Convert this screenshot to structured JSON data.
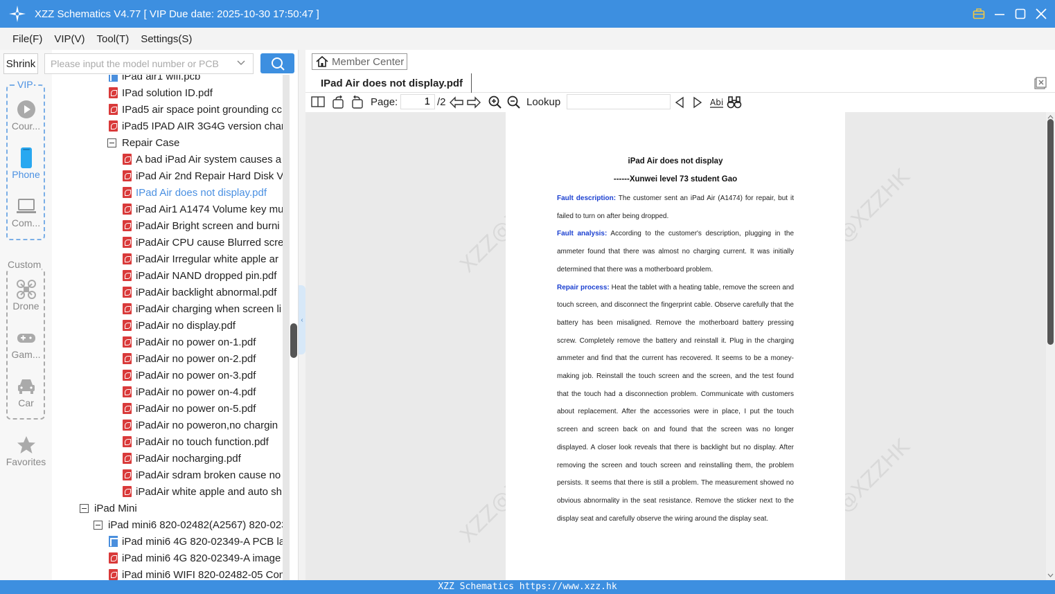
{
  "window": {
    "title": "XZZ Schematics V4.77 [ VIP Due date: 2025-10-30 17:50:47 ]"
  },
  "menu": [
    "File(F)",
    "VIP(V)",
    "Tool(T)",
    "Settings(S)"
  ],
  "search": {
    "shrink_label": "Shrink",
    "placeholder": "Please input the model number or PCB"
  },
  "sidebar": {
    "vip_label": "VIP",
    "custom_label": "Custom",
    "items": [
      {
        "label": "Cour...",
        "icon": "play-icon"
      },
      {
        "label": "Phone",
        "icon": "phone-icon"
      },
      {
        "label": "Com...",
        "icon": "laptop-icon"
      },
      {
        "label": "Drone",
        "icon": "drone-icon"
      },
      {
        "label": "Gam...",
        "icon": "gamepad-icon"
      },
      {
        "label": "Car",
        "icon": "car-icon"
      },
      {
        "label": "Favorites",
        "icon": "star-icon"
      }
    ]
  },
  "tree": {
    "rows": [
      {
        "text": "iPad air1 wifi.pcb",
        "type": "pcb"
      },
      {
        "text": "IPad solution ID.pdf",
        "type": "pdf"
      },
      {
        "text": "IPad5 air space point grounding cc",
        "type": "pdf"
      },
      {
        "text": "iPad5 IPAD AIR 3G4G version chan",
        "type": "pdf"
      },
      {
        "text": "Repair Case",
        "type": "folder"
      },
      {
        "text": "A bad iPad Air system causes a",
        "type": "pdf"
      },
      {
        "text": "iPad Air 2nd Repair Hard Disk V",
        "type": "pdf"
      },
      {
        "text": "IPad Air does not display.pdf",
        "type": "pdf",
        "selected": true
      },
      {
        "text": "iPad Air1 A1474 Volume key mu",
        "type": "pdf"
      },
      {
        "text": "iPadAir Bright screen and burni",
        "type": "pdf"
      },
      {
        "text": "iPadAir CPU cause Blurred scree",
        "type": "pdf"
      },
      {
        "text": "iPadAir Irregular white apple ar",
        "type": "pdf"
      },
      {
        "text": "iPadAir NAND dropped pin.pdf",
        "type": "pdf"
      },
      {
        "text": "iPadAir backlight abnormal.pdf",
        "type": "pdf"
      },
      {
        "text": "iPadAir charging when screen li",
        "type": "pdf"
      },
      {
        "text": "iPadAir no display.pdf",
        "type": "pdf"
      },
      {
        "text": "iPadAir no power on-1.pdf",
        "type": "pdf"
      },
      {
        "text": "iPadAir no power on-2.pdf",
        "type": "pdf"
      },
      {
        "text": "iPadAir no power on-3.pdf",
        "type": "pdf"
      },
      {
        "text": "iPadAir no power on-4.pdf",
        "type": "pdf"
      },
      {
        "text": "iPadAir no power on-5.pdf",
        "type": "pdf"
      },
      {
        "text": "iPadAir no poweron,no chargin",
        "type": "pdf"
      },
      {
        "text": "iPadAir no touch function.pdf",
        "type": "pdf"
      },
      {
        "text": "iPadAir nocharging.pdf",
        "type": "pdf"
      },
      {
        "text": "iPadAir sdram broken cause no",
        "type": "pdf"
      },
      {
        "text": "iPadAir white apple and auto sh",
        "type": "pdf"
      },
      {
        "text": "iPad Mini",
        "type": "folder"
      },
      {
        "text": "iPad mini6 820-02482(A2567) 820-023",
        "type": "folder"
      },
      {
        "text": "iPad mini6 4G 820-02349-A PCB la",
        "type": "pcb"
      },
      {
        "text": "iPad mini6 4G 820-02349-A image",
        "type": "pdf"
      },
      {
        "text": "iPad mini6 WIFI 820-02482-05 Con",
        "type": "pdf"
      }
    ]
  },
  "viewer": {
    "member_center": "Member Center",
    "tab_title": "IPad Air does not display.pdf",
    "page_label": "Page:",
    "page_current": "1",
    "page_total": "/2",
    "lookup_label": "Lookup",
    "watermark": "XZZ@XZZHK"
  },
  "document": {
    "title": "iPad Air does not display",
    "subtitle": "------Xunwei level 73 student Gao",
    "fault_description_label": "Fault description:",
    "fault_description": " The customer sent an iPad Air (A1474) for repair, but it failed to turn on after being dropped.",
    "fault_analysis_label": "Fault analysis:",
    "fault_analysis": " According to the customer's description, plugging in the ammeter found that there was almost no charging current. It was initially determined that there was a motherboard problem.",
    "repair_process_label": "Repair process:",
    "repair_process": " Heat the tablet with a heating table, remove the screen and touch screen, and disconnect the fingerprint cable. Observe carefully that the battery has been misaligned. Remove the motherboard battery pressing screw. Completely remove the battery and reinstall it. Plug in the charging ammeter and find that the current has recovered. It seems to be a money-making job. Reinstall the touch screen and the screen, and the test found that the touch had a disconnection problem. Communicate with customers about replacement. After the accessories were in place, I put the touch screen and screen back on and found that the screen was no longer displayed. A closer look reveals that there is backlight but no display. After removing the screen and touch screen and reinstalling them, the problem persists. It seems that there is still a problem. The measurement showed no obvious abnormality in the seat resistance. Remove the sticker next to the display seat and carefully observe the wiring around the display seat."
  },
  "status": {
    "text": "XZZ Schematics https://www.xzz.hk"
  },
  "colors": {
    "accent": "#3d8fe0",
    "selected": "#4a90e2",
    "pdf_icon": "#d93a3a",
    "doc_label": "#1a3fd0"
  }
}
